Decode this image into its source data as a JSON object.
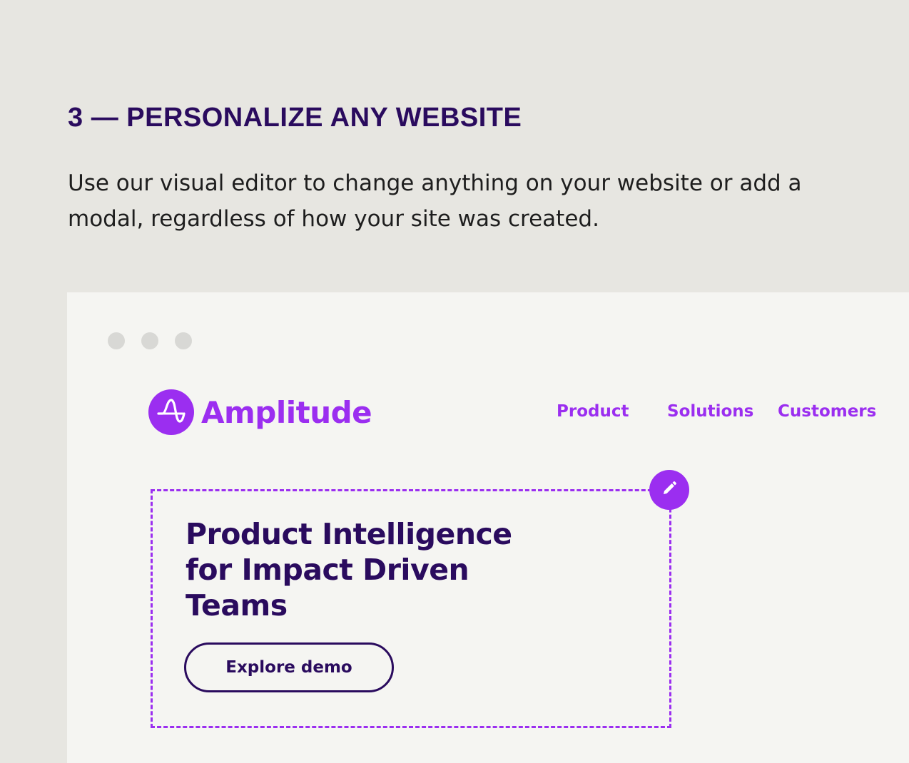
{
  "section": {
    "heading": "3 — PERSONALIZE ANY WEBSITE",
    "description": "Use our visual editor to change anything on your website or add a modal, regardless of how your site was created."
  },
  "mockup": {
    "logo_text": "Amplitude",
    "nav": {
      "product": "Product",
      "solutions": "Solutions",
      "customers": "Customers"
    },
    "hero": {
      "title": "Product Intelligence for Impact Driven Teams",
      "cta_label": "Explore demo"
    }
  },
  "colors": {
    "heading": "#2a0b5e",
    "accent": "#9b2ef0",
    "page_background": "#e7e6e1",
    "frame_background": "#f5f5f2"
  },
  "icons": {
    "logo": "amplitude-logo-icon",
    "edit": "pencil-icon"
  }
}
